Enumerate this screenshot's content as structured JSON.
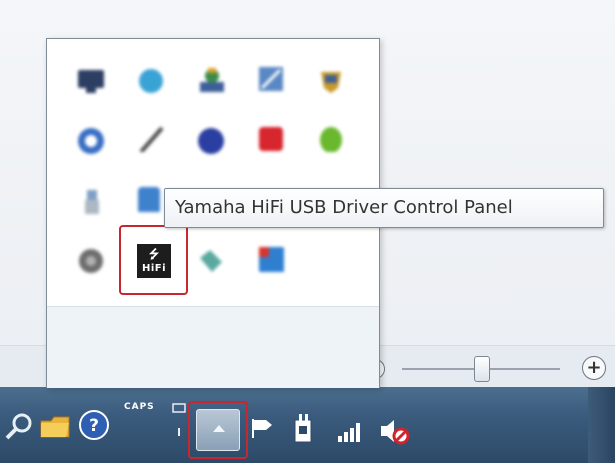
{
  "tooltip": {
    "text": "Yamaha HiFi USB Driver Control Panel"
  },
  "hidden_tray": {
    "highlighted_icon": {
      "name": "yamaha-hifi-usb-icon",
      "usb_glyph": "⭍",
      "label": "HiFi"
    },
    "icons": [
      "monitor-icon",
      "globe-icon",
      "network-icon",
      "image-icon",
      "shield-icon",
      "sync-icon",
      "pen-icon",
      "blue-circle-icon",
      "red-square-icon",
      "green-shield-icon",
      "usb-stick-icon",
      "blue-device-icon",
      "gear-icon",
      "teal-icon",
      "blue-app-icon"
    ]
  },
  "taskbar": {
    "caps_indicator": "CAPS",
    "show_hidden_icons_button": {
      "icon": "chevron-up-icon"
    },
    "help_glyph": "?",
    "tray_icons": [
      "search-icon",
      "folder-icon",
      "help-icon",
      "keyboard-icon",
      "flag-icon",
      "power-icon",
      "signal-icon",
      "volume-muted-icon"
    ]
  },
  "zoom": {
    "plus_label": "+",
    "level": 0.5
  },
  "colors": {
    "highlight": "#c9272f",
    "taskbar": "#3b5c7e",
    "tooltip_text": "#333333"
  }
}
